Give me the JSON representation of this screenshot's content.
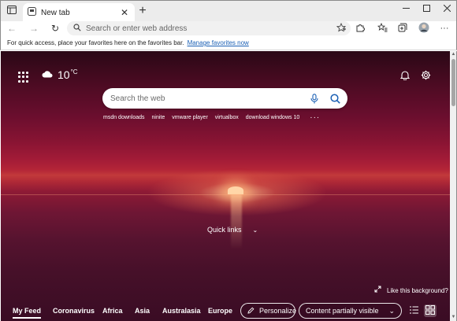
{
  "tab": {
    "label": "New tab",
    "close_glyph": "✕",
    "new_tab_glyph": "+"
  },
  "window": {
    "minimize_glyph": "—",
    "maximize_glyph": "☐",
    "close_glyph": "✕"
  },
  "toolbar": {
    "back_glyph": "←",
    "forward_glyph": "→",
    "refresh_glyph": "↻",
    "address_placeholder": "Search or enter web address",
    "address_value": ""
  },
  "favorites_bar": {
    "message": "For quick access, place your favorites here on the favorites bar.",
    "link": "Manage favorites now"
  },
  "newtab": {
    "weather": {
      "temp": "10",
      "unit": "°C",
      "icon": "cloud-icon"
    },
    "search_placeholder": "Search the web",
    "suggestions": [
      "msdn downloads",
      "ninite",
      "vmware player",
      "virtualbox",
      "download windows 10"
    ],
    "suggestions_more": "···",
    "quick_links": "Quick links",
    "quick_links_chevron": "⌄",
    "like_background": "Like this background?",
    "feed": {
      "items": [
        "My Feed",
        "Coronavirus",
        "Africa",
        "Asia",
        "Australasia",
        "Europe"
      ],
      "active_index": 0,
      "personalize": "Personalize",
      "content_visibility": "Content partially visible",
      "content_visibility_chevron": "⌄"
    }
  },
  "colors": {
    "accent_link": "#1a5fb4",
    "tab_strip": "#ececec",
    "sky_top": "#2a0816",
    "sky_mid": "#a21b37",
    "sea": "#461029"
  }
}
